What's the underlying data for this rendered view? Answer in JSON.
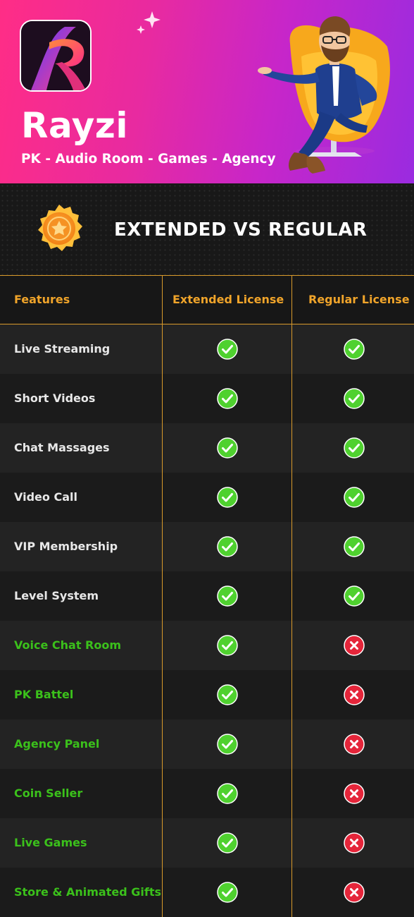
{
  "hero": {
    "brand": "Rayzi",
    "tagline": "PK - Audio Room - Games - Agency"
  },
  "section": {
    "heading": "EXTENDED VS REGULAR"
  },
  "table": {
    "columns": [
      "Features",
      "Extended License",
      "Regular License"
    ],
    "rows": [
      {
        "feature": "Live Streaming",
        "extended": true,
        "regular": true,
        "highlight": false
      },
      {
        "feature": "Short Videos",
        "extended": true,
        "regular": true,
        "highlight": false
      },
      {
        "feature": "Chat Massages",
        "extended": true,
        "regular": true,
        "highlight": false
      },
      {
        "feature": "Video Call",
        "extended": true,
        "regular": true,
        "highlight": false
      },
      {
        "feature": "VIP Membership",
        "extended": true,
        "regular": true,
        "highlight": false
      },
      {
        "feature": "Level System",
        "extended": true,
        "regular": true,
        "highlight": false
      },
      {
        "feature": "Voice Chat Room",
        "extended": true,
        "regular": false,
        "highlight": true
      },
      {
        "feature": "PK Battel",
        "extended": true,
        "regular": false,
        "highlight": true
      },
      {
        "feature": "Agency Panel",
        "extended": true,
        "regular": false,
        "highlight": true
      },
      {
        "feature": "Coin Seller",
        "extended": true,
        "regular": false,
        "highlight": true
      },
      {
        "feature": "Live Games",
        "extended": true,
        "regular": false,
        "highlight": true
      },
      {
        "feature": "Store & Animated Gifts",
        "extended": true,
        "regular": false,
        "highlight": true
      }
    ]
  },
  "icons": {
    "included": "check-icon",
    "excluded": "cross-icon",
    "heading_badge": "medal-star-icon"
  },
  "colors": {
    "accent": "#f0a42a",
    "included_green": "#4fd12f",
    "excluded_red": "#e5253a",
    "highlight_text": "#3bc11b"
  }
}
